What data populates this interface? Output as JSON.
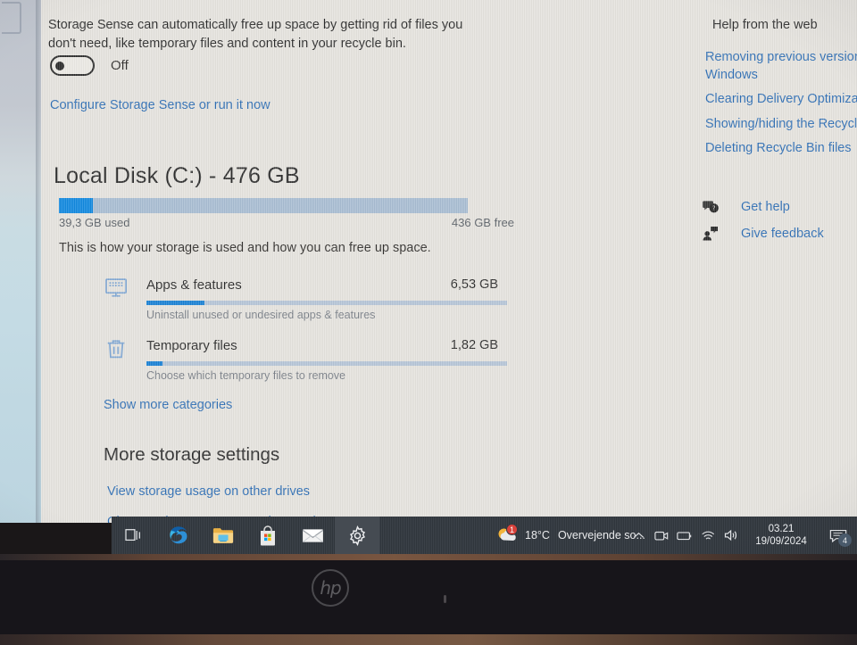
{
  "storage_sense": {
    "description": "Storage Sense can automatically free up space by getting rid of files you don't need, like temporary files and content in your recycle bin.",
    "toggle_state": "Off",
    "configure_link": "Configure Storage Sense or run it now"
  },
  "disk": {
    "title": "Local Disk (C:) - 476 GB",
    "used_label": "39,3 GB used",
    "free_label": "436 GB free",
    "subtitle": "This is how your storage is used and how you can free up space.",
    "used_percent": 8.3,
    "bar_fill_color": "#1189e0",
    "bar_track_color": "#a9bed3"
  },
  "categories": [
    {
      "icon": "monitor-icon",
      "name": "Apps & features",
      "size": "6,53 GB",
      "description": "Uninstall unused or undesired apps & features",
      "bar_percent": 16
    },
    {
      "icon": "trash-icon",
      "name": "Temporary files",
      "size": "1,82 GB",
      "description": "Choose which temporary files to remove",
      "bar_percent": 4.5
    }
  ],
  "show_more_categories": "Show more categories",
  "more_settings": {
    "heading": "More storage settings",
    "links": [
      "View storage usage on other drives",
      "Change where new content is saved"
    ]
  },
  "help": {
    "heading": "Help from the web",
    "links": [
      "Removing previous versions of",
      "Windows",
      "Clearing Delivery Optimization cach",
      "Showing/hiding the Recycle Bin",
      "Deleting Recycle Bin files"
    ],
    "support": [
      {
        "icon": "help-bubble-icon",
        "label": "Get help"
      },
      {
        "icon": "feedback-person-icon",
        "label": "Give feedback"
      }
    ]
  },
  "taskbar": {
    "buttons": [
      {
        "icon": "task-view-icon",
        "name": "task-view",
        "active": false
      },
      {
        "icon": "edge-icon",
        "name": "microsoft-edge",
        "active": false
      },
      {
        "icon": "file-explorer-icon",
        "name": "file-explorer",
        "active": false
      },
      {
        "icon": "microsoft-store-icon",
        "name": "microsoft-store",
        "active": false
      },
      {
        "icon": "mail-icon",
        "name": "mail",
        "active": false
      },
      {
        "icon": "settings-gear-icon",
        "name": "settings",
        "active": true
      }
    ],
    "weather": {
      "temperature": "18°C",
      "condition": "Overvejende so...",
      "badge": "1"
    },
    "tray_icons": [
      "chevron-up-icon",
      "camera-icon",
      "battery-icon",
      "wifi-icon",
      "volume-icon"
    ],
    "clock": {
      "time": "03.21",
      "date": "19/09/2024"
    },
    "action_center": {
      "icon": "action-center-icon",
      "badge": "4"
    }
  },
  "device": {
    "brand": "hp"
  }
}
